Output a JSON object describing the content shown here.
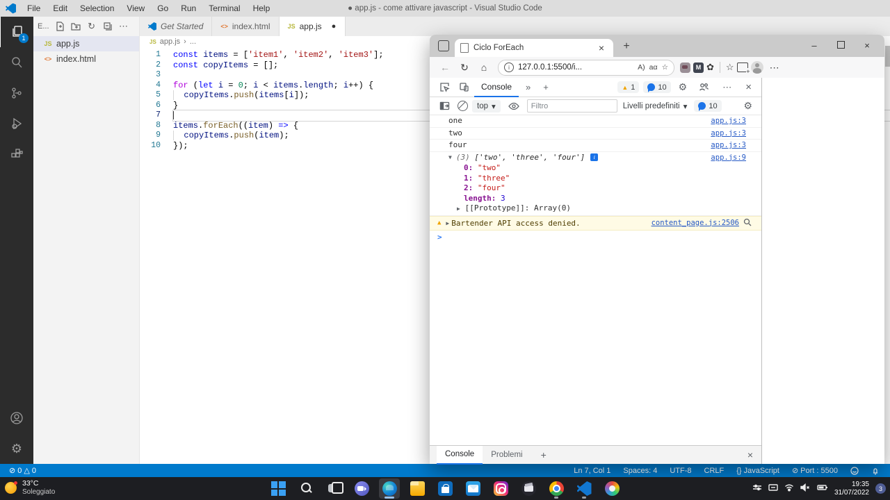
{
  "icons": {
    "modified_dot": "●",
    "close": "×",
    "minimize": "–",
    "plus": "+",
    "chevrons": "»",
    "gear": "⚙",
    "more": "⋯",
    "caret_down": "▾",
    "back": "←",
    "refresh": "↻",
    "home": "⌂",
    "star": "☆",
    "flower": "✿",
    "info_i": "i",
    "ext_m": "M",
    "read_aloud": "A)",
    "translate": "aα",
    "breadcrumb_sep": "›",
    "breadcrumb_more": "...",
    "error_icon": "⊘",
    "warning_icon": "△",
    "braces": "{}",
    "refresh_small": "↻"
  },
  "vscode": {
    "window_title": "● app.js - come attivare javascript - Visual Studio Code",
    "menus": [
      "File",
      "Edit",
      "Selection",
      "View",
      "Go",
      "Run",
      "Terminal",
      "Help"
    ],
    "activity_badge": "1",
    "explorer": {
      "header": "E...",
      "files": [
        {
          "name": "app.js",
          "glyph": "JS",
          "cls": "js",
          "active": true
        },
        {
          "name": "index.html",
          "glyph": "<>",
          "cls": "html",
          "active": false
        }
      ]
    },
    "tabs": [
      {
        "label": "Get Started",
        "icon": "logo",
        "glyph": "",
        "preview": true,
        "active": false,
        "modified": false
      },
      {
        "label": "index.html",
        "icon": "html",
        "glyph": "<>",
        "preview": false,
        "active": false,
        "modified": false
      },
      {
        "label": "app.js",
        "icon": "js",
        "glyph": "JS",
        "preview": false,
        "active": true,
        "modified": true
      }
    ],
    "breadcrumb": {
      "glyph": "JS",
      "file": "app.js"
    },
    "code": {
      "lines": [
        {
          "n": "1",
          "current": false,
          "tokens": [
            [
              "kw",
              "const"
            ],
            [
              "pl",
              " "
            ],
            [
              "v",
              "items"
            ],
            [
              "pl",
              " = ["
            ],
            [
              "s",
              "'item1'"
            ],
            [
              "pl",
              ", "
            ],
            [
              "s",
              "'item2'"
            ],
            [
              "pl",
              ", "
            ],
            [
              "s",
              "'item3'"
            ],
            [
              "pl",
              "];"
            ]
          ]
        },
        {
          "n": "2",
          "current": false,
          "tokens": [
            [
              "kw",
              "const"
            ],
            [
              "pl",
              " "
            ],
            [
              "v",
              "copyItems"
            ],
            [
              "pl",
              " = [];"
            ]
          ]
        },
        {
          "n": "3",
          "current": false,
          "tokens": []
        },
        {
          "n": "4",
          "current": false,
          "tokens": [
            [
              "ctrl",
              "for"
            ],
            [
              "pl",
              " ("
            ],
            [
              "kw",
              "let"
            ],
            [
              "pl",
              " "
            ],
            [
              "v",
              "i"
            ],
            [
              "pl",
              " = "
            ],
            [
              "n",
              "0"
            ],
            [
              "pl",
              "; "
            ],
            [
              "v",
              "i"
            ],
            [
              "pl",
              " < "
            ],
            [
              "v",
              "items"
            ],
            [
              "pl",
              "."
            ],
            [
              "v",
              "length"
            ],
            [
              "pl",
              "; "
            ],
            [
              "v",
              "i"
            ],
            [
              "pl",
              "++) {"
            ]
          ]
        },
        {
          "n": "5",
          "current": false,
          "tokens": [
            [
              "ind",
              "  "
            ],
            [
              "v",
              "copyItems"
            ],
            [
              "pl",
              "."
            ],
            [
              "fn",
              "push"
            ],
            [
              "pl",
              "("
            ],
            [
              "v",
              "items"
            ],
            [
              "pl",
              "["
            ],
            [
              "v",
              "i"
            ],
            [
              "pl",
              "]);"
            ]
          ]
        },
        {
          "n": "6",
          "current": false,
          "tokens": [
            [
              "pl",
              "}"
            ]
          ]
        },
        {
          "n": "7",
          "current": true,
          "tokens": []
        },
        {
          "n": "8",
          "current": false,
          "tokens": [
            [
              "v",
              "items"
            ],
            [
              "pl",
              "."
            ],
            [
              "fn",
              "forEach"
            ],
            [
              "pl",
              "(("
            ],
            [
              "v",
              "item"
            ],
            [
              "pl",
              ") "
            ],
            [
              "kw",
              "=>"
            ],
            [
              "pl",
              " {"
            ]
          ]
        },
        {
          "n": "9",
          "current": false,
          "tokens": [
            [
              "ind",
              "  "
            ],
            [
              "v",
              "copyItems"
            ],
            [
              "pl",
              "."
            ],
            [
              "fn",
              "push"
            ],
            [
              "pl",
              "("
            ],
            [
              "v",
              "item"
            ],
            [
              "pl",
              ");"
            ]
          ]
        },
        {
          "n": "10",
          "current": false,
          "tokens": [
            [
              "pl",
              "});"
            ]
          ]
        }
      ]
    },
    "status": {
      "errors": "0",
      "warnings": "0",
      "ln": "Ln 7, Col 1",
      "spaces": "Spaces: 4",
      "enc": "UTF-8",
      "eol": "CRLF",
      "lang": "JavaScript",
      "port": "Port : 5500"
    }
  },
  "browser": {
    "tab_title": "Ciclo ForEach",
    "url": "127.0.0.1:5500/i...",
    "devtools": {
      "tab": "Console",
      "warn_count": "1",
      "msg_count": "10",
      "context": "top",
      "filter_placeholder": "Filtro",
      "levels": "Livelli predefiniti",
      "messages": [
        {
          "type": "log",
          "text": "one",
          "source": "app.js:3"
        },
        {
          "type": "log",
          "text": "two",
          "source": "app.js:3"
        },
        {
          "type": "log",
          "text": "four",
          "source": "app.js:3"
        },
        {
          "type": "array",
          "caret": "▼",
          "count": "(3)",
          "body": "['two', 'three', 'four']",
          "source": "app.js:9",
          "entries": [
            [
              "0",
              "\"two\""
            ],
            [
              "1",
              "\"three\""
            ],
            [
              "2",
              "\"four\""
            ],
            [
              "length",
              "3"
            ]
          ],
          "proto_caret": "▶",
          "proto": "[[Prototype]]: Array(0)"
        }
      ],
      "warning": {
        "caret": "▶",
        "text": "Bartender API access denied.",
        "source": "content_page.js:2506"
      },
      "prompt": ">",
      "drawer": {
        "tabs": [
          {
            "label": "Console",
            "active": true
          },
          {
            "label": "Problemi",
            "active": false
          }
        ]
      }
    }
  },
  "taskbar": {
    "weather": {
      "temp": "33°C",
      "condition": "Soleggiato"
    },
    "apps": [
      {
        "n": "start"
      },
      {
        "n": "search"
      },
      {
        "n": "taskview"
      },
      {
        "n": "chat"
      },
      {
        "n": "edge",
        "active": true,
        "running": true
      },
      {
        "n": "explorer"
      },
      {
        "n": "store"
      },
      {
        "n": "mail"
      },
      {
        "n": "instagram"
      },
      {
        "n": "clipchamp"
      },
      {
        "n": "chrome",
        "running": true
      },
      {
        "n": "vscode",
        "running": true
      },
      {
        "n": "paint"
      }
    ],
    "tray": {
      "time": "19:35",
      "date": "31/07/2022",
      "badge": "3"
    }
  }
}
